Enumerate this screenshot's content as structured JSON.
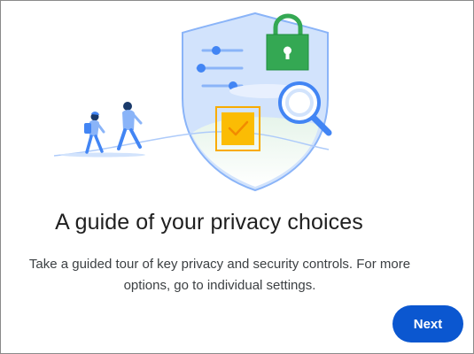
{
  "dialog": {
    "title": "A guide of your privacy choices",
    "description": "Take a guided tour of key privacy and security controls. For more options, go to individual settings.",
    "next_label": "Next"
  },
  "icons": {
    "illustration": "privacy-shield-illustration",
    "lock": "lock-icon",
    "magnifier": "magnifier-icon",
    "checkbox": "checkbox-icon",
    "sliders": "sliders-icon",
    "walkers": "people-walking-illustration"
  },
  "colors": {
    "accent": "#0b57d0",
    "lock_green": "#34a853",
    "check_yellow": "#fbbc04",
    "shield_blue": "#d2e3fc",
    "people_blue": "#4285f4"
  }
}
